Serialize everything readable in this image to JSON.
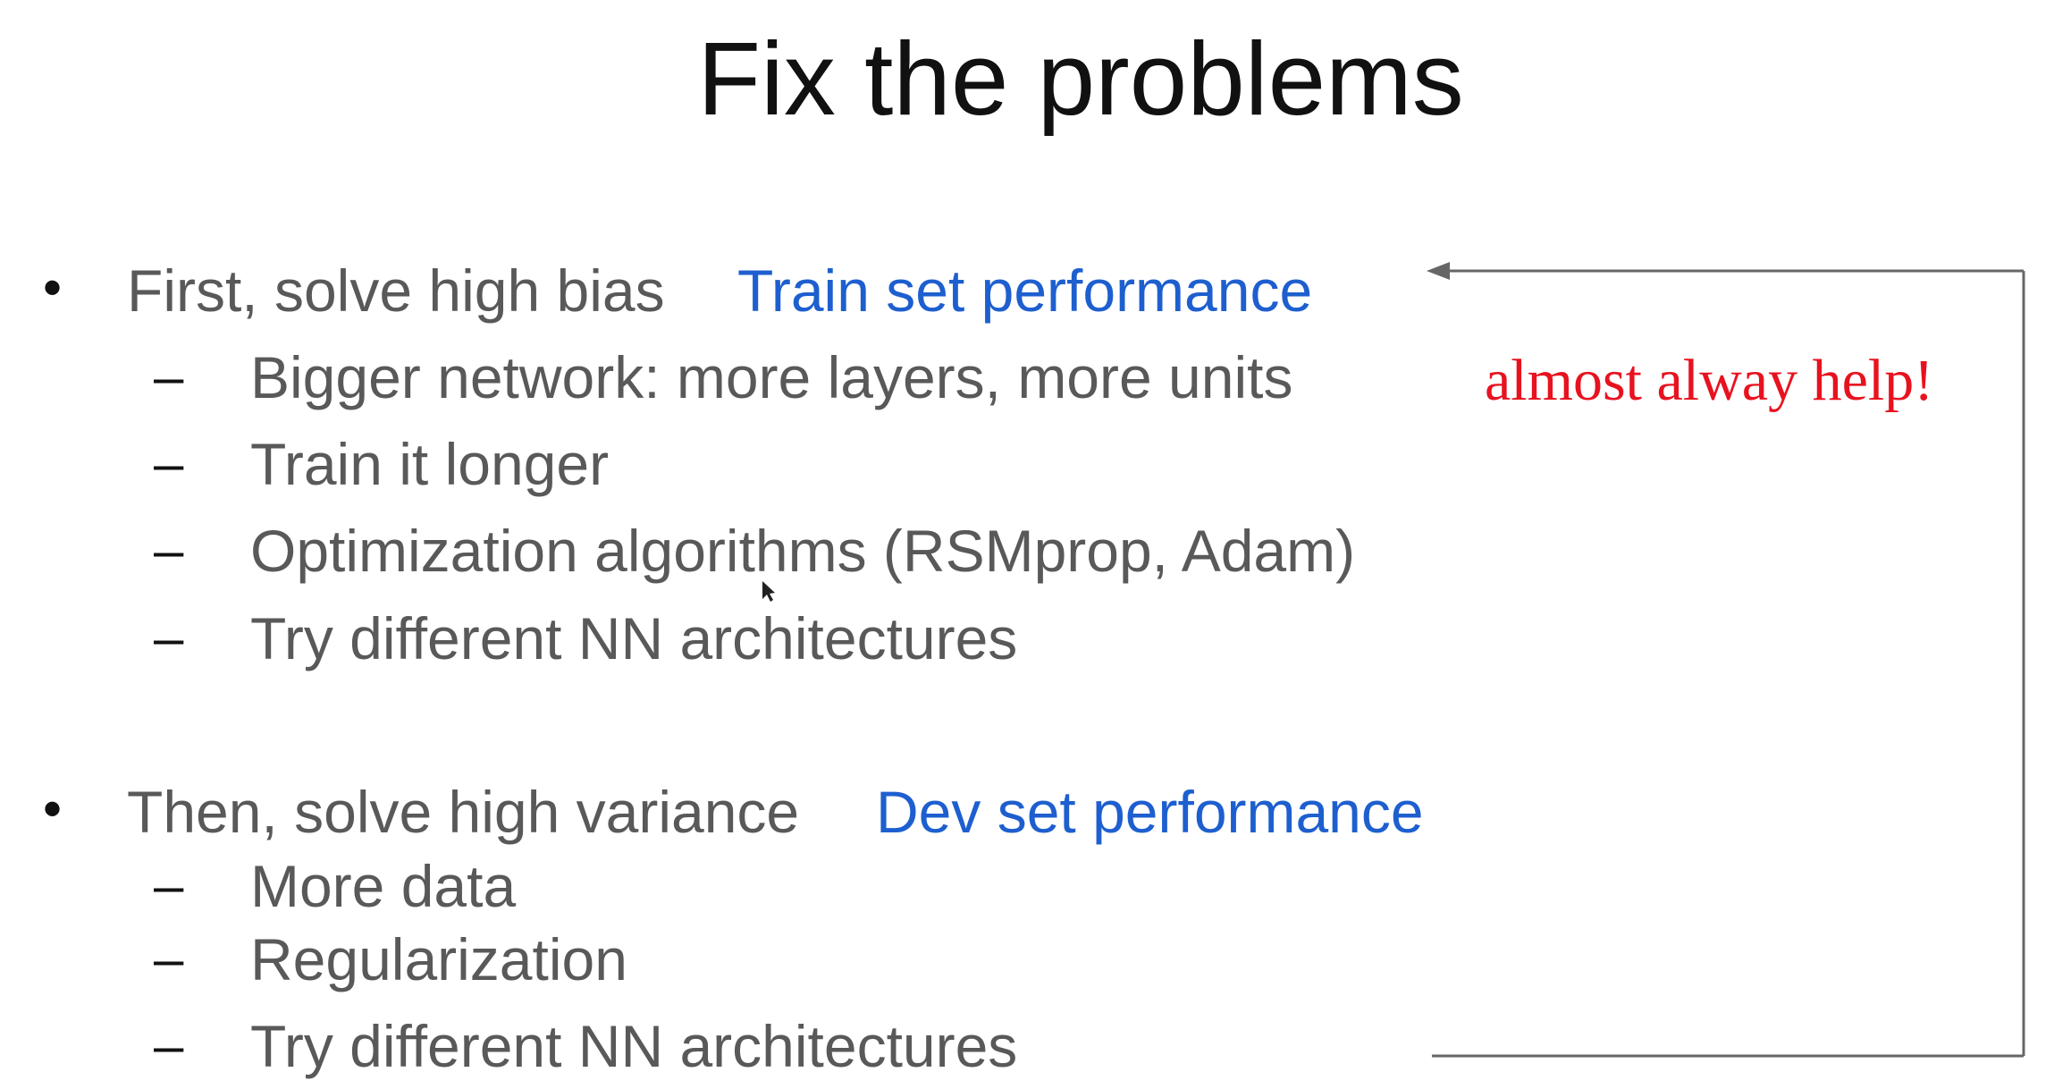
{
  "title": "Fix the problems",
  "sections": [
    {
      "bullet": "First, solve high bias",
      "tag": "Train set performance",
      "items": [
        "Bigger network: more layers, more units",
        "Train it longer",
        "Optimization algorithms (RSMprop, Adam)",
        "Try different NN architectures"
      ]
    },
    {
      "bullet": "Then, solve high variance",
      "tag": "Dev set performance",
      "items": [
        "More data",
        "Regularization",
        "Try different NN architectures"
      ]
    }
  ],
  "annotation": "almost alway help!",
  "symbols": {
    "bullet": "•",
    "dash": "–"
  },
  "colors": {
    "text": "#595959",
    "accent_blue": "#1e5fcf",
    "annotation_red": "#e8121f",
    "arrow": "#666666"
  }
}
